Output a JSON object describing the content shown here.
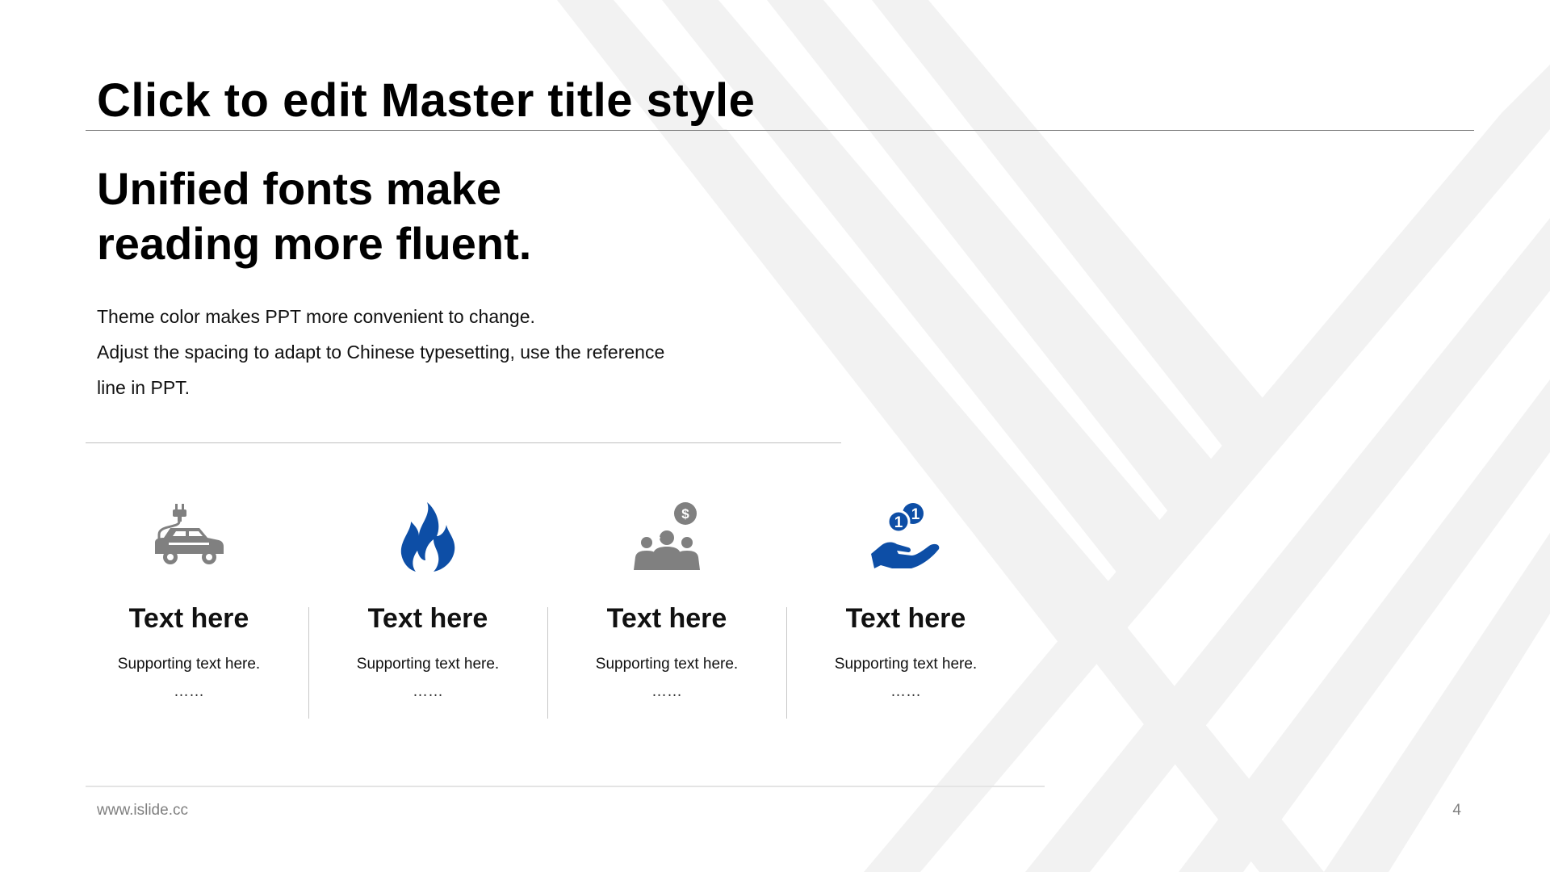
{
  "slide": {
    "title": "Click to edit Master title style",
    "headline_lines": [
      "Unified fonts make",
      "reading more fluent."
    ],
    "body_lines": [
      "Theme color makes PPT more convenient to change.",
      "Adjust the spacing to adapt to Chinese typesetting, use the reference",
      "line in PPT."
    ],
    "features": [
      {
        "icon": "electric-car-icon",
        "title": "Text here",
        "subtitle": "Supporting  text here.",
        "dots": "……",
        "icon_color": "#808080"
      },
      {
        "icon": "flame-icon",
        "title": "Text here",
        "subtitle": "Supporting  text here.",
        "dots": "……",
        "icon_color": "#0d4ea6"
      },
      {
        "icon": "group-money-icon",
        "title": "Text here",
        "subtitle": "Supporting  text here.",
        "dots": "……",
        "icon_color": "#808080"
      },
      {
        "icon": "hand-coins-icon",
        "title": "Text here",
        "subtitle": "Supporting  text here.",
        "dots": "……",
        "icon_color": "#0d4ea6"
      }
    ],
    "footer": {
      "url": "www.islide.cc",
      "page_number": "4"
    },
    "colors": {
      "accent_blue": "#0d4ea6",
      "icon_gray": "#808080",
      "decor_stripe": "#f0f0f0"
    }
  }
}
